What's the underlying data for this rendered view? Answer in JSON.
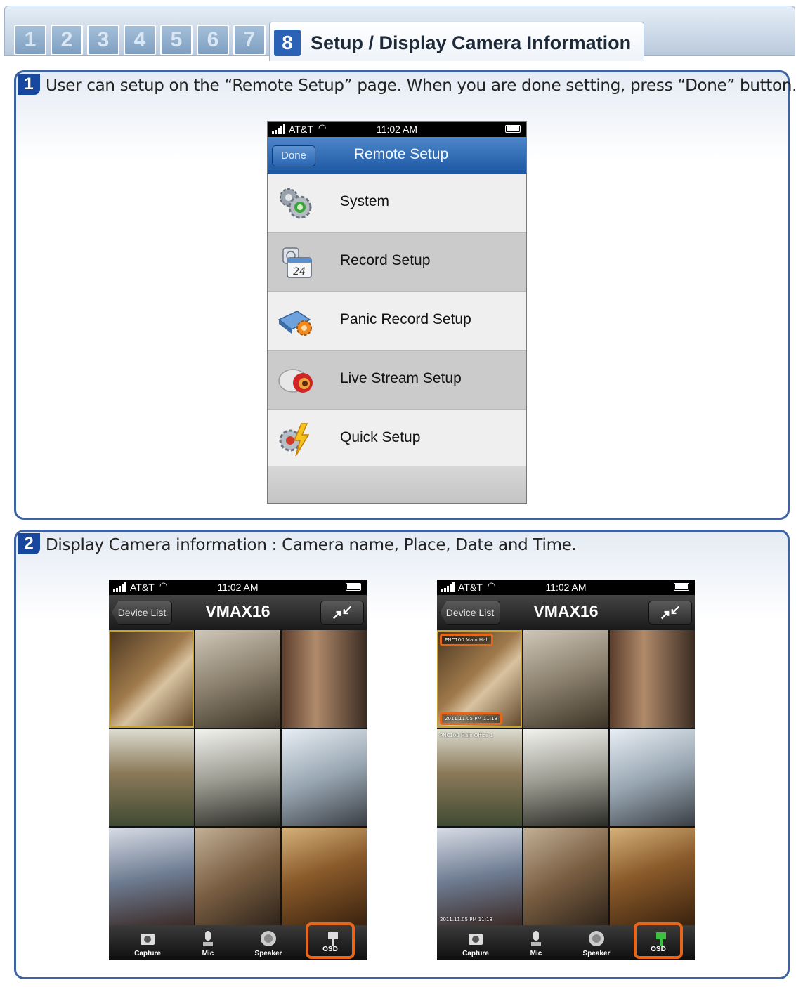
{
  "tabs": {
    "numbers": [
      "1",
      "2",
      "3",
      "4",
      "5",
      "6",
      "7"
    ],
    "active_number": "8",
    "active_title": "Setup / Display Camera Information"
  },
  "step1": {
    "number": "1",
    "text": "User can setup on the “Remote Setup” page. When you are done setting, press “Done” button.",
    "phone": {
      "status": {
        "carrier": "AT&T",
        "time": "11:02 AM"
      },
      "nav": {
        "done_label": "Done",
        "title": "Remote Setup"
      },
      "menu": [
        {
          "label": "System",
          "icon": "gears-icon"
        },
        {
          "label": "Record Setup",
          "icon": "calendar-24-icon"
        },
        {
          "label": "Panic Record Setup",
          "icon": "panic-record-icon"
        },
        {
          "label": "Live Stream Setup",
          "icon": "live-stream-icon"
        },
        {
          "label": "Quick Setup",
          "icon": "quick-setup-icon"
        }
      ]
    }
  },
  "step2": {
    "number": "2",
    "text": "Display Camera information : Camera name, Place, Date and Time.",
    "phone": {
      "status": {
        "carrier": "AT&T",
        "time": "11:02 AM"
      },
      "nav": {
        "back_label": "Device List",
        "title": "VMAX16"
      },
      "toolbar": [
        {
          "label": "Capture",
          "icon": "camera-icon"
        },
        {
          "label": "Mic",
          "icon": "microphone-icon"
        },
        {
          "label": "Speaker",
          "icon": "speaker-icon"
        },
        {
          "label": "OSD",
          "icon": "osd-icon"
        }
      ]
    },
    "osd_samples": {
      "name1": "PNC100 Main Hall",
      "date1": "2011.11.05 PM 11:18",
      "name4": "PNC100 Main Office 1"
    }
  },
  "colors": {
    "accent_blue": "#2a63b6",
    "panel_border": "#3d63a2",
    "highlight_orange": "#e8661a",
    "nav_blue": "#1c57a3"
  }
}
